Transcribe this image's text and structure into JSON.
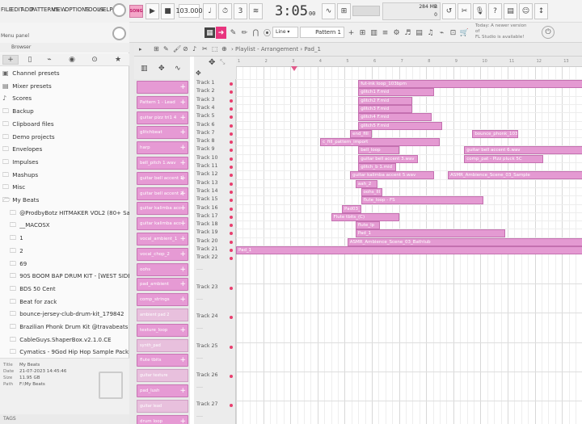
{
  "menu": {
    "items": [
      "FILE",
      "EDIT",
      "ADD",
      "PATTERNS",
      "VIEW",
      "OPTIONS",
      "TOOLS",
      "HELP"
    ]
  },
  "transport": {
    "song_label": "SONG",
    "tempo": "103.000",
    "time": "3:05",
    "time_sub": "00"
  },
  "cpu": {
    "cpu": "2",
    "memory": "284 MB",
    "voices": "0"
  },
  "toolbar": {
    "snap": "Line",
    "pattern": "Pattern 1"
  },
  "notice": {
    "line1": "Today: A newer version of",
    "line2": "FL Studio is available!"
  },
  "panel": {
    "label": "Menu panel",
    "browser_label": "Browser"
  },
  "browser": {
    "items": [
      {
        "label": "Channel presets",
        "sub": false,
        "icon": "list-icon"
      },
      {
        "label": "Mixer presets",
        "sub": false,
        "icon": "mixer-icon"
      },
      {
        "label": "Scores",
        "sub": false,
        "icon": "note-icon"
      },
      {
        "label": "Backup",
        "sub": false,
        "icon": "folder-icon"
      },
      {
        "label": "Clipboard files",
        "sub": false,
        "icon": "folder-icon"
      },
      {
        "label": "Demo projects",
        "sub": false,
        "icon": "folder-icon"
      },
      {
        "label": "Envelopes",
        "sub": false,
        "icon": "folder-icon"
      },
      {
        "label": "Impulses",
        "sub": false,
        "icon": "folder-icon"
      },
      {
        "label": "Mashups",
        "sub": false,
        "icon": "folder-icon"
      },
      {
        "label": "Misc",
        "sub": false,
        "icon": "folder-icon"
      },
      {
        "label": "My Beats",
        "sub": false,
        "icon": "folder-open-icon"
      },
      {
        "label": "@ProdbyBotz HITMAKER VOL2 (80+ Sample Pack)",
        "sub": true,
        "icon": "folder-icon"
      },
      {
        "label": "__MACOSX",
        "sub": true,
        "icon": "folder-icon"
      },
      {
        "label": "1",
        "sub": true,
        "icon": "folder-icon"
      },
      {
        "label": "2",
        "sub": true,
        "icon": "folder-icon"
      },
      {
        "label": "69",
        "sub": true,
        "icon": "folder-icon"
      },
      {
        "label": "90S BOOM BAP DRUM KIT - [WEST SIDE] 2023",
        "sub": true,
        "icon": "folder-icon"
      },
      {
        "label": "BDS 50 Cent",
        "sub": true,
        "icon": "folder-icon"
      },
      {
        "label": "Beat for zack",
        "sub": true,
        "icon": "folder-icon"
      },
      {
        "label": "bounce-jersey-club-drum-kit_179842",
        "sub": true,
        "icon": "folder-icon"
      },
      {
        "label": "Brazilian Phonk Drum Kit @travabeats",
        "sub": true,
        "icon": "folder-icon"
      },
      {
        "label": "CableGuys.ShaperBox.v2.1.0.CE",
        "sub": true,
        "icon": "folder-icon"
      },
      {
        "label": "Cymatics - 9God Hip Hop Sample Pack",
        "sub": true,
        "icon": "folder-icon"
      }
    ]
  },
  "file_info": {
    "title_k": "Title",
    "title_v": "My Beats",
    "date_k": "Date",
    "date_v": "21-07-2023 14:45:46",
    "size_k": "Size",
    "size_v": "11.95 GB",
    "path_k": "Path",
    "path_v": "F:\\My Beats"
  },
  "tags_label": "TAGS",
  "playlist": {
    "title": "Playlist - Arrangement",
    "pattern": "Pad_1"
  },
  "picker_items": [
    "",
    "Pattern 1 - Lead",
    "guitar pizz tri1 4",
    "glitchbeat",
    "harp",
    "bell_pitch 1.wav",
    "guitar bell accent 1",
    "guitar bell accent 2",
    "guitar kalimba acc",
    "guitar kalimba acc",
    "vocal_ambient_1",
    "vocal_chop_2",
    "oohs",
    "pad_ambient",
    "comp_strings",
    "ambient pad 2",
    "texture_loop",
    "synth_pad",
    "flute tbits",
    "guitar texture",
    "pad_lush",
    "guitar lead",
    "drum loop"
  ],
  "tracks": [
    "Track 1",
    "Track 2",
    "Track 3",
    "Track 4",
    "Track 5",
    "Track 6",
    "Track 7",
    "Track 8",
    "Track 9",
    "Track 10",
    "Track 11",
    "Track 12",
    "Track 13",
    "Track 14",
    "Track 15",
    "Track 16",
    "Track 17",
    "Track 18",
    "Track 19",
    "Track 20",
    "Track 21",
    "Track 22",
    "Track 23",
    "Track 24",
    "Track 25",
    "Track 26",
    "Track 27"
  ],
  "ruler": [
    "1",
    "2",
    "3",
    "4",
    "5",
    "6",
    "7",
    "8",
    "9",
    "10",
    "11",
    "12",
    "13"
  ],
  "clips": [
    {
      "t": 0,
      "s": 4.5,
      "e": 13,
      "label": "fut-ink loop_103bpm"
    },
    {
      "t": 1,
      "s": 4.5,
      "e": 7.3,
      "label": "glitch1 F.mid"
    },
    {
      "t": 2,
      "s": 4.5,
      "e": 6.5,
      "label": "glitch2 F.mid"
    },
    {
      "t": 3,
      "s": 4.5,
      "e": 6.5,
      "label": "glitch3 F.mid"
    },
    {
      "t": 4,
      "s": 4.5,
      "e": 7.2,
      "label": "glitch4 F.mid"
    },
    {
      "t": 5,
      "s": 4.5,
      "e": 7.6,
      "label": "glitch5 F.mid"
    },
    {
      "t": 6,
      "s": 4.2,
      "e": 5,
      "label": "end_fill"
    },
    {
      "t": 6,
      "s": 8.7,
      "e": 10.4,
      "label": "bounce_phonk_103bpm"
    },
    {
      "t": 7,
      "s": 3.1,
      "e": 7.5,
      "label": "c_fill_pattern_import"
    },
    {
      "t": 8,
      "s": 4.5,
      "e": 6,
      "label": "bell_loop"
    },
    {
      "t": 8,
      "s": 8.4,
      "e": 13,
      "label": "guitar bell accent 6.wav"
    },
    {
      "t": 9,
      "s": 4.5,
      "e": 6.7,
      "label": "guitar bell accent 3.wav"
    },
    {
      "t": 9,
      "s": 8.4,
      "e": 11.3,
      "label": "comp_pat - Pizz pluck 5C"
    },
    {
      "t": 10,
      "s": 4.5,
      "e": 5.9,
      "label": "glitch_b 1.mid"
    },
    {
      "t": 11,
      "s": 4.2,
      "e": 7.3,
      "label": "guitar kalimba accent 5.wav"
    },
    {
      "t": 11,
      "s": 7.8,
      "e": 13,
      "label": "ASMR_Ambience_Scene_03_Sample"
    },
    {
      "t": 12,
      "s": 4.4,
      "e": 5.2,
      "label": "aah_2"
    },
    {
      "t": 13,
      "s": 4.6,
      "e": 5.4,
      "label": "oohs_III"
    },
    {
      "t": 14,
      "s": 4.6,
      "e": 9.1,
      "label": "flute_loop - FS"
    },
    {
      "t": 15,
      "s": 3.9,
      "e": 4.6,
      "label": "Pad03_TB"
    },
    {
      "t": 16,
      "s": 3.5,
      "e": 6,
      "label": "Flute tbits_(C)"
    },
    {
      "t": 17,
      "s": 4.4,
      "e": 5.3,
      "label": "flute_lp"
    },
    {
      "t": 18,
      "s": 4.4,
      "e": 9.9,
      "label": "Pad_1"
    },
    {
      "t": 19,
      "s": 4.1,
      "e": 13,
      "label": "ASMR_Ambience_Scene_03_Bathtub"
    },
    {
      "t": 20,
      "s": 0,
      "e": 13,
      "label": "Pad_1"
    }
  ]
}
